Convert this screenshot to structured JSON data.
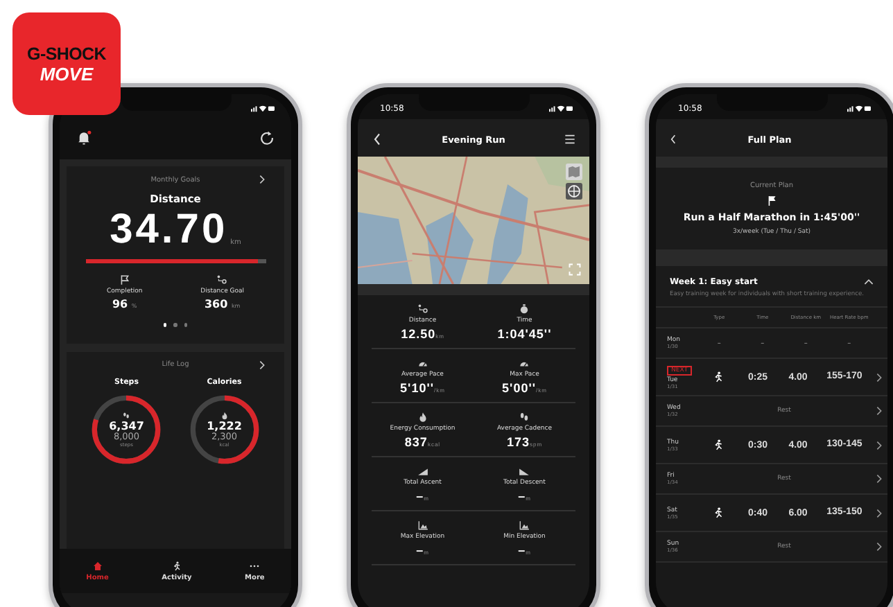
{
  "logo": {
    "line1": "G-SHOCK",
    "line2": "MOVE"
  },
  "home_screen": {
    "bell_badge": true,
    "monthly_goals": {
      "title": "Monthly Goals",
      "metric": "Distance",
      "value": "34.70",
      "unit": "km",
      "level": 0.96,
      "stats": [
        {
          "kind": "flag",
          "label": "Completion",
          "value": "96",
          "unit": "%"
        },
        {
          "kind": "route",
          "label": "Distance Goal",
          "value": "360",
          "unit": "km"
        }
      ],
      "pages": [
        {
          "selected": true
        },
        {
          "selected": false
        },
        {
          "selected": false
        }
      ]
    },
    "life_log": {
      "title": "Life Log",
      "rings": [
        {
          "kind": "footsteps",
          "label": "Steps",
          "value": "6,347",
          "goal": "8,000",
          "unit": "steps",
          "level": 0.8
        },
        {
          "kind": "flame",
          "label": "Calories",
          "value": "1,222",
          "goal": "2,300",
          "unit": "kcal",
          "level": 0.53
        }
      ]
    },
    "nav": [
      {
        "kind": "home",
        "label": "Home",
        "selected": true
      },
      {
        "kind": "runner",
        "label": "Activity",
        "selected": false
      },
      {
        "kind": "dots",
        "label": "More",
        "selected": false
      }
    ]
  },
  "run_screen": {
    "time": "10:58",
    "title": "Evening Run",
    "stats": [
      {
        "kind": "route",
        "label": "Distance",
        "value": "12.50",
        "unit": "km"
      },
      {
        "kind": "stopwatch",
        "label": "Time",
        "value": "1:04'45''"
      },
      {
        "kind": "pace",
        "label": "Average Pace",
        "value": "5'10''",
        "unit": "/km"
      },
      {
        "kind": "pace",
        "label": "Max Pace",
        "value": "5'00''",
        "unit": "/km"
      },
      {
        "kind": "flame",
        "label": "Energy Consumption",
        "value": "837",
        "unit": "kcal"
      },
      {
        "kind": "footsteps",
        "label": "Average Cadence",
        "value": "173",
        "unit": "spm"
      },
      {
        "kind": "ascent",
        "label": "Total Ascent",
        "value": "–",
        "unit": "m"
      },
      {
        "kind": "descent",
        "label": "Total Descent",
        "value": "–",
        "unit": "m"
      },
      {
        "kind": "elevation",
        "label": "Max Elevation",
        "value": "–",
        "unit": "m"
      },
      {
        "kind": "elevation",
        "label": "Min Elevation",
        "value": "–",
        "unit": "m"
      }
    ]
  },
  "plan_screen": {
    "time": "10:58",
    "title": "Full Plan",
    "current_plan": {
      "heading": "Current Plan",
      "goal": "Run a Half Marathon in 1:45'00''",
      "schedule": "3x/week (Tue / Thu / Sat)"
    },
    "week": {
      "title": "Week 1: Easy start",
      "expanded": true,
      "description": "Easy training week for individuals with short training experience.",
      "columns": [
        "Type",
        "Time",
        "Distance km",
        "Heart Rate bpm"
      ],
      "rows": [
        {
          "kind": "none",
          "day": "Mon",
          "date": "1/30",
          "cells": [
            "–",
            "–",
            "–",
            "–"
          ]
        },
        {
          "kind": "run",
          "day": "Tue",
          "date": "1/31",
          "tag": "NEXT",
          "time": "0:25",
          "distance": "4.00",
          "heart_rate": "155-170"
        },
        {
          "kind": "rest",
          "day": "Wed",
          "date": "1/32",
          "note": "Rest"
        },
        {
          "kind": "run",
          "day": "Thu",
          "date": "1/33",
          "time": "0:30",
          "distance": "4.00",
          "heart_rate": "130-145"
        },
        {
          "kind": "rest",
          "day": "Fri",
          "date": "1/34",
          "note": "Rest"
        },
        {
          "kind": "run",
          "day": "Sat",
          "date": "1/35",
          "time": "0:40",
          "distance": "6.00",
          "heart_rate": "135-150"
        },
        {
          "kind": "rest",
          "day": "Sun",
          "date": "1/36",
          "note": "Rest"
        }
      ]
    }
  }
}
